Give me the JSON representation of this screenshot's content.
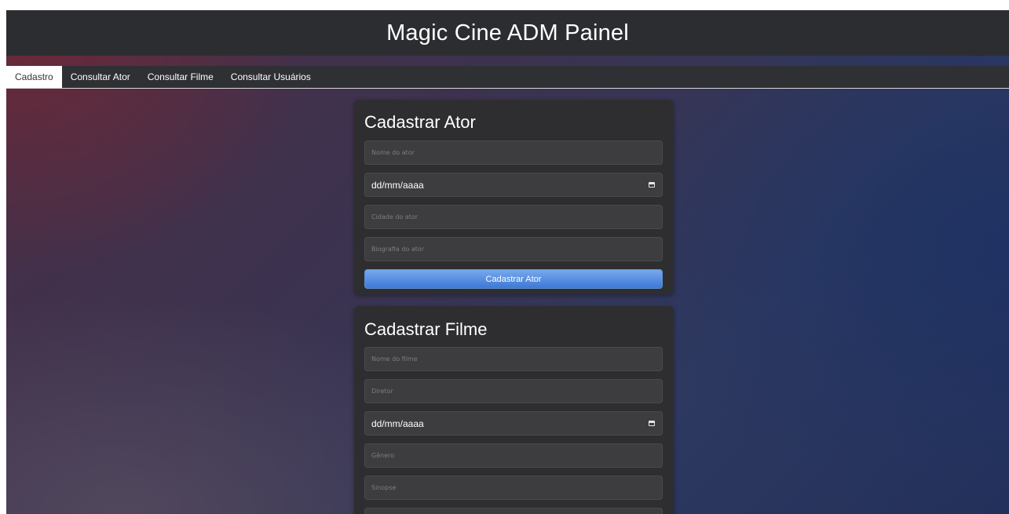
{
  "header": {
    "title": "Magic Cine ADM Painel"
  },
  "nav": {
    "tabs": [
      {
        "label": "Cadastro",
        "active": true
      },
      {
        "label": "Consultar Ator",
        "active": false
      },
      {
        "label": "Consultar Filme",
        "active": false
      },
      {
        "label": "Consultar Usuários",
        "active": false
      }
    ]
  },
  "actor_form": {
    "title": "Cadastrar Ator",
    "name_placeholder": "Nome do ator",
    "date_value": "dd/mm/aaaa",
    "city_placeholder": "Cidade do ator",
    "bio_placeholder": "Biografia do ator",
    "submit_label": "Cadastrar Ator"
  },
  "movie_form": {
    "title": "Cadastrar Filme",
    "name_placeholder": "Nome do filme",
    "director_placeholder": "Diretor",
    "date_value": "dd/mm/aaaa",
    "genre_placeholder": "Gênero",
    "synopsis_placeholder": "Sinopse"
  },
  "colors": {
    "header_bg": "#2c2d30",
    "card_bg": "#2e2e30",
    "button_accent": "#3d79d6"
  }
}
